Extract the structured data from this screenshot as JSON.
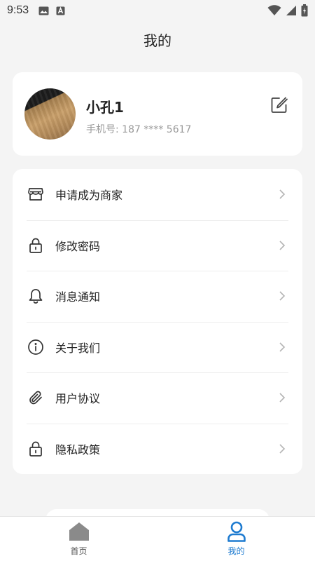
{
  "status_bar": {
    "time": "9:53",
    "icons": [
      "image-icon",
      "a-icon",
      "wifi-icon",
      "signal-icon",
      "battery-icon"
    ]
  },
  "header": {
    "title": "我的"
  },
  "profile": {
    "name": "小孔1",
    "phone": "手机号: 187 **** 5617"
  },
  "menu": {
    "items": [
      {
        "label": "申请成为商家",
        "icon": "store-icon"
      },
      {
        "label": "修改密码",
        "icon": "lock-icon"
      },
      {
        "label": "消息通知",
        "icon": "bell-icon"
      },
      {
        "label": "关于我们",
        "icon": "info-icon"
      },
      {
        "label": "用户协议",
        "icon": "paperclip-icon"
      },
      {
        "label": "隐私政策",
        "icon": "lock-icon"
      }
    ]
  },
  "tab_bar": {
    "tabs": [
      {
        "label": "首页",
        "icon": "home-icon",
        "active": false
      },
      {
        "label": "我的",
        "icon": "user-icon",
        "active": true
      }
    ],
    "active_color": "#1e7bd0",
    "inactive_color": "#555555"
  }
}
